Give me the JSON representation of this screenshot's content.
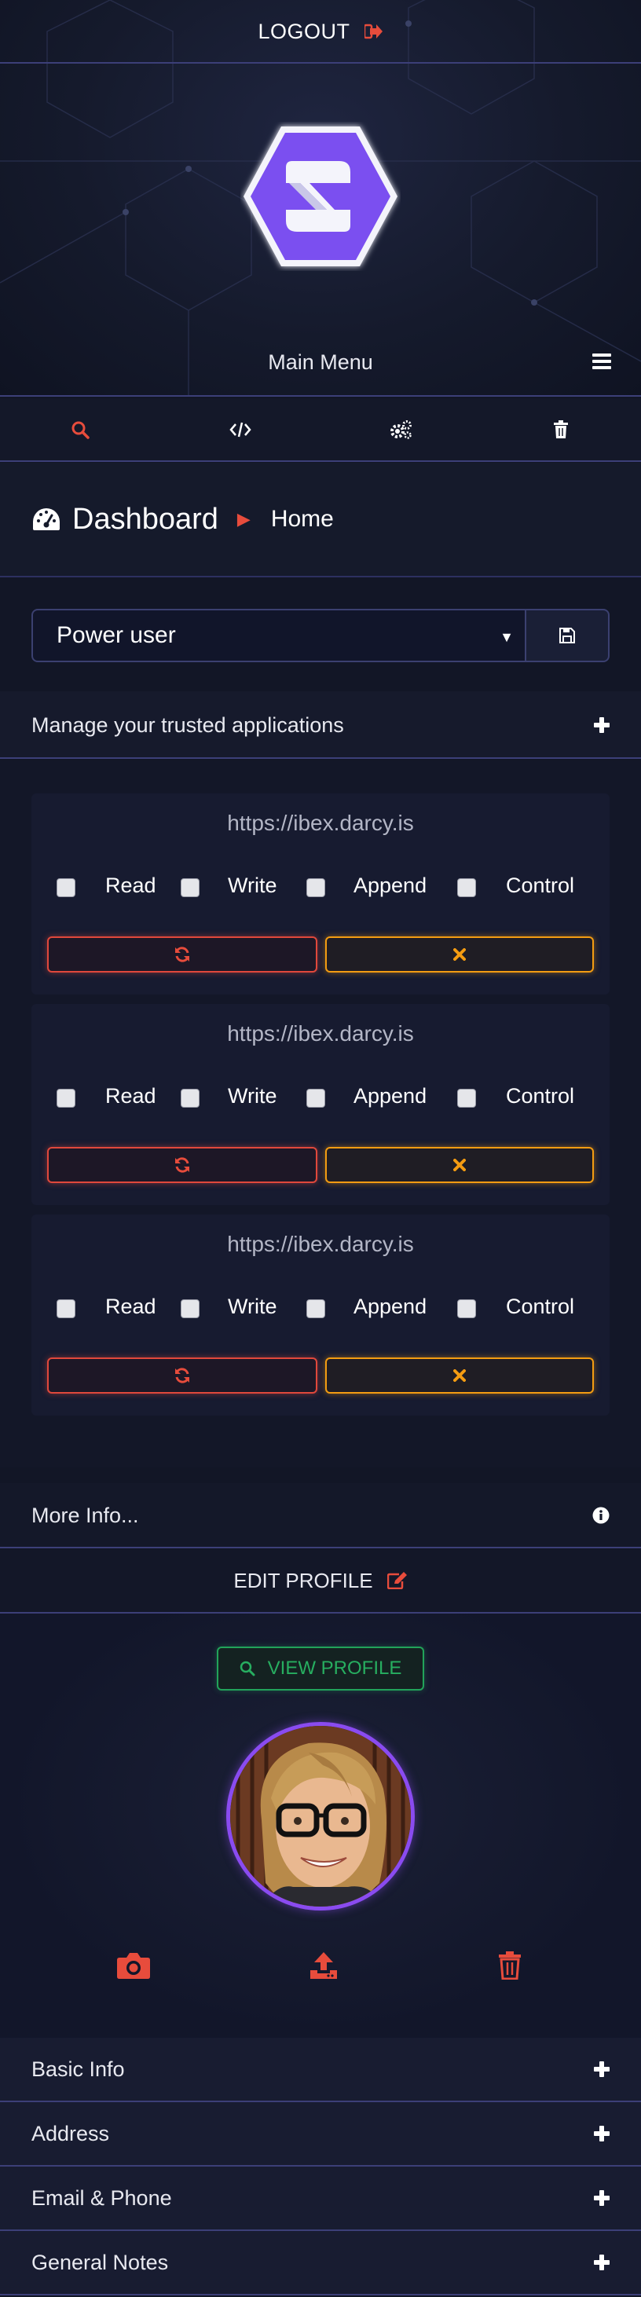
{
  "header": {
    "logout_label": "LOGOUT",
    "main_menu_label": "Main Menu"
  },
  "toolbar": {
    "icons": [
      "search-icon",
      "code-icon",
      "gears-icon",
      "trash-icon"
    ]
  },
  "breadcrumb": {
    "title": "Dashboard",
    "current": "Home"
  },
  "role": {
    "selected": "Power user"
  },
  "trusted_apps": {
    "header": "Manage your trusted applications",
    "apps": [
      {
        "url": "https://ibex.darcy.is"
      },
      {
        "url": "https://ibex.darcy.is"
      },
      {
        "url": "https://ibex.darcy.is"
      }
    ],
    "permissions": [
      "Read",
      "Write",
      "Append",
      "Control"
    ]
  },
  "more_info_label": "More Info...",
  "profile": {
    "edit_label": "EDIT PROFILE",
    "view_label": "VIEW PROFILE"
  },
  "sections": [
    "Basic Info",
    "Address",
    "Email & Phone",
    "General Notes"
  ],
  "colors": {
    "accent_red": "#e74c3c",
    "accent_orange": "#f39c12",
    "accent_green": "#27ae60",
    "accent_purple": "#8a4bf0",
    "divider": "#3c3f78",
    "background": "#121626"
  }
}
